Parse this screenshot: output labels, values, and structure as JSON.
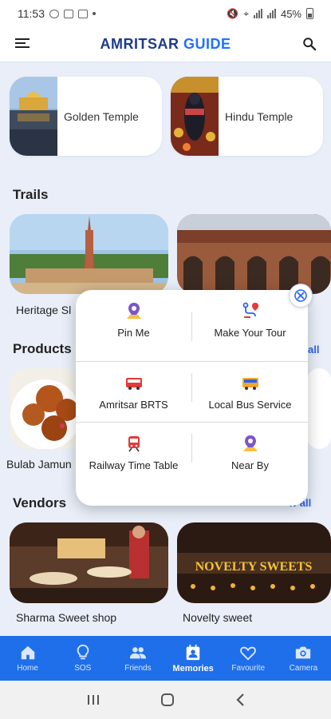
{
  "status_bar": {
    "time": "11:53",
    "battery": "45%"
  },
  "app": {
    "title_part1": "AMRITSAR",
    "title_part2": "GUIDE"
  },
  "feature_cards": [
    {
      "label": "Golden Temple"
    },
    {
      "label": "Hindu Temple"
    }
  ],
  "sections": {
    "trails": {
      "title": "Trails"
    },
    "products": {
      "title": "Products",
      "view_all": "all"
    },
    "vendors": {
      "title": "Vendors",
      "view_all": "w all"
    }
  },
  "trail_cards": [
    {
      "label": "Heritage Sl"
    }
  ],
  "product_cards": [
    {
      "label": "Bulab Jamun"
    }
  ],
  "vendor_cards": [
    {
      "label": "Sharma Sweet shop"
    },
    {
      "label": "Novelty sweet",
      "sign": "NOVELTY SWEETS"
    }
  ],
  "popup_menu": {
    "items": [
      {
        "label": "Pin Me",
        "icon": "pin-icon"
      },
      {
        "label": "Make Your Tour",
        "icon": "route-icon"
      },
      {
        "label": "Amritsar BRTS",
        "icon": "bus-icon"
      },
      {
        "label": "Local Bus Service",
        "icon": "bus-icon"
      },
      {
        "label": "Railway Time Table",
        "icon": "train-icon"
      },
      {
        "label": "Near By",
        "icon": "pin-icon"
      }
    ]
  },
  "bottom_nav": {
    "items": [
      {
        "label": "Home",
        "icon": "home-icon"
      },
      {
        "label": "SOS",
        "icon": "bulb-icon"
      },
      {
        "label": "Friends",
        "icon": "friends-icon"
      },
      {
        "label": "Memories",
        "icon": "memories-icon"
      },
      {
        "label": "Favourite",
        "icon": "heart-icon"
      },
      {
        "label": "Camera",
        "icon": "camera-icon"
      }
    ],
    "active": "Memories"
  },
  "colors": {
    "accent": "#1f6fea",
    "brand_dark": "#1c3b8c",
    "brand_light": "#1f72ff"
  }
}
